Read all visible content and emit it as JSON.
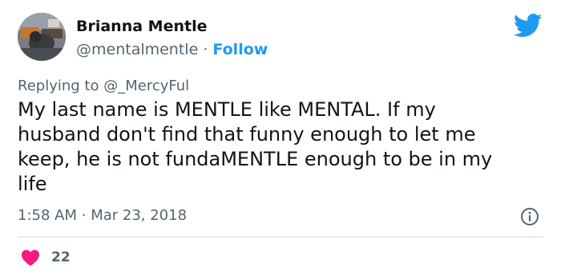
{
  "author": {
    "name": "Brianna Mentle",
    "handle": "@mentalmentle",
    "separator": "·",
    "follow_label": "Follow"
  },
  "reply": {
    "prefix": "Replying to",
    "mention": "@_MercyFul"
  },
  "tweet": {
    "text": "My last name is MENTLE like MENTAL. If my\nhusband don't find that funny enough to let me\nkeep, he is not fundaMENTLE enough to be in my\nlife"
  },
  "meta": {
    "time": "1:58 AM",
    "separator": "·",
    "date": "Mar 23, 2018"
  },
  "engagement": {
    "likes": "22"
  },
  "icons": {
    "brand": "twitter-bird-icon",
    "info": "info-icon",
    "like": "heart-icon"
  },
  "colors": {
    "accent": "#1d9bf0",
    "heart": "#f91880",
    "text": "#0f1419",
    "muted": "#536471",
    "divider": "#cfd9de"
  }
}
